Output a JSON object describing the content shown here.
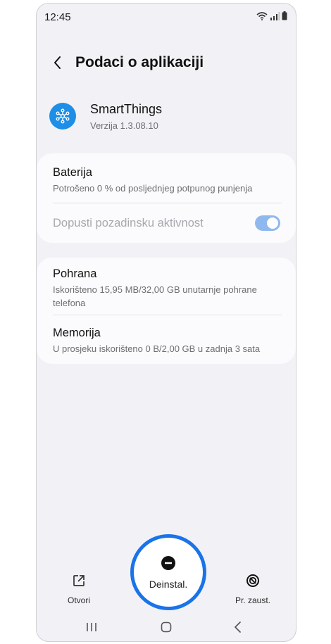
{
  "status_bar": {
    "time": "12:45"
  },
  "header": {
    "title": "Podaci o aplikaciji"
  },
  "app": {
    "name": "SmartThings",
    "version": "Verzija 1.3.08.10",
    "icon": "smartthings-icon",
    "icon_color": "#1e8ee6"
  },
  "card1": {
    "battery": {
      "title": "Baterija",
      "subtitle": "Potrošeno 0 % od posljednjeg potpunog punjenja"
    },
    "background_activity": {
      "title": "Dopusti pozadinsku aktivnost",
      "toggle_on": true,
      "disabled": true
    }
  },
  "card2": {
    "storage": {
      "title": "Pohrana",
      "subtitle": "Iskorišteno 15,95 MB/32,00 GB unutarnje pohrane telefona"
    },
    "memory": {
      "title": "Memorija",
      "subtitle": "U prosjeku iskorišteno 0 B/2,00 GB u zadnja 3 sata"
    }
  },
  "actions": {
    "open": {
      "label": "Otvori",
      "icon": "open-external-icon"
    },
    "uninstall": {
      "label": "Deinstal.",
      "icon": "minus-circle-icon"
    },
    "force_stop": {
      "label": "Pr. zaust.",
      "icon": "stop-icon"
    }
  },
  "accent_color": "#1a73e8"
}
